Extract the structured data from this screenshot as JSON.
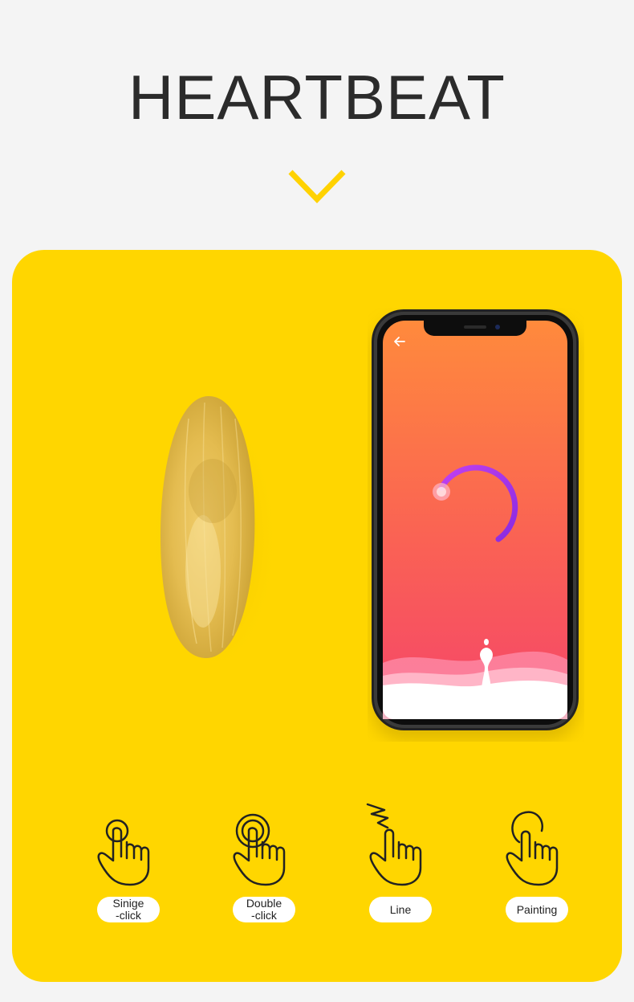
{
  "header": {
    "title": "HEARTBEAT"
  },
  "gestures": [
    {
      "label_1": "Sinige",
      "label_2": "-click",
      "icon": "single-click-hand-icon"
    },
    {
      "label_1": "Double",
      "label_2": "-click",
      "icon": "double-click-hand-icon"
    },
    {
      "label_1": "Line",
      "label_2": "",
      "icon": "line-hand-icon"
    },
    {
      "label_1": "Painting",
      "label_2": "",
      "icon": "painting-hand-icon"
    }
  ],
  "colors": {
    "background": "#f4f4f4",
    "panel": "#ffd600",
    "accent": "#ffd200",
    "phone_gradient_top": "#ff8a3c",
    "phone_gradient_bottom": "#f5456a",
    "arc": "#a13cf0"
  }
}
